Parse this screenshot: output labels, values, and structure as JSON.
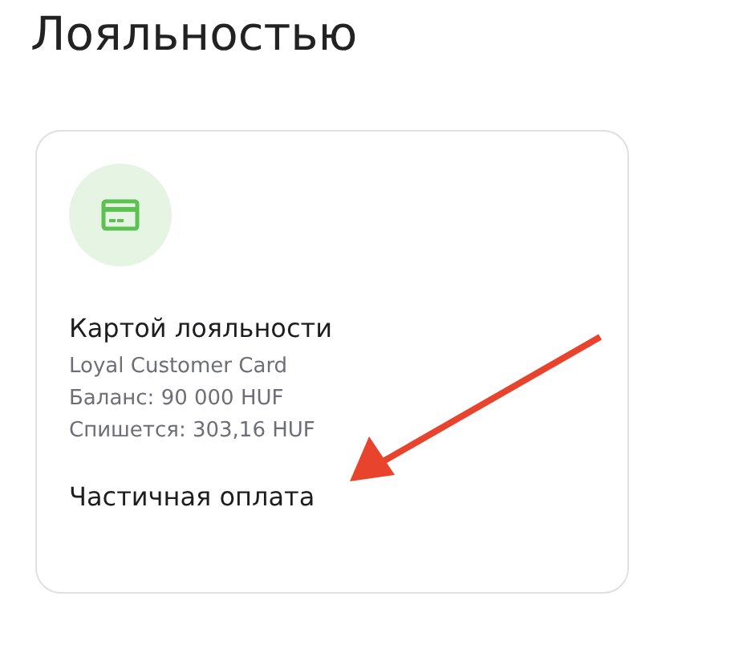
{
  "heading": "Лояльностью",
  "payment_option": {
    "title": "Картой лояльности",
    "details": [
      "Loyal Customer Card",
      "Баланс: 90 000 HUF",
      "Спишется: 303,16 HUF"
    ],
    "mode": "Частичная оплата"
  }
}
